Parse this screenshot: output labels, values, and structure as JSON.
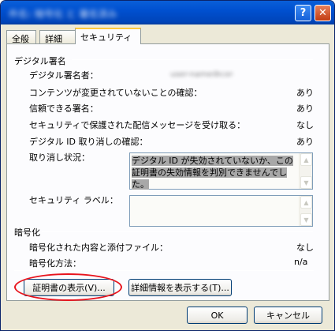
{
  "window": {
    "title": "件名: 暗号化 と 署名済み",
    "help_glyph": "?",
    "close_glyph": "✕"
  },
  "tabs": [
    {
      "label": "全般"
    },
    {
      "label": "詳細"
    },
    {
      "label": "セキュリティ"
    }
  ],
  "digital_signature": {
    "section_title": "デジタル署名",
    "signer_label": "デジタル署名者：",
    "signer_value": "user-name@corp.example.jp",
    "rows": [
      {
        "label": "コンテンツが変更されていないことの確認：",
        "value": "あり"
      },
      {
        "label": "信頼できる署名：",
        "value": "あり"
      },
      {
        "label": "セキュリティで保護された配信メッセージを受け取る：",
        "value": "なし"
      },
      {
        "label": "デジタル ID 取り消しの確認：",
        "value": "あり"
      }
    ],
    "revocation_label": "取り消し状況：",
    "revocation_text": "デジタル ID が失効されていないか、この証明書の失効情報を判別できませんでした。",
    "security_label": "セキュリティ ラベル：",
    "security_text": ""
  },
  "encryption": {
    "section_title": "暗号化",
    "rows": [
      {
        "label": "暗号化された内容と添付ファイル：",
        "value": "なし"
      },
      {
        "label": "暗号化方法：",
        "value": "n/a"
      }
    ]
  },
  "buttons": {
    "view_cert": "証明書の表示(V)...",
    "details": "詳細情報を表示する(T)...",
    "ok": "OK",
    "cancel": "キャンセル"
  },
  "icons": {
    "scroll_up": "▲",
    "scroll_down": "▼"
  }
}
